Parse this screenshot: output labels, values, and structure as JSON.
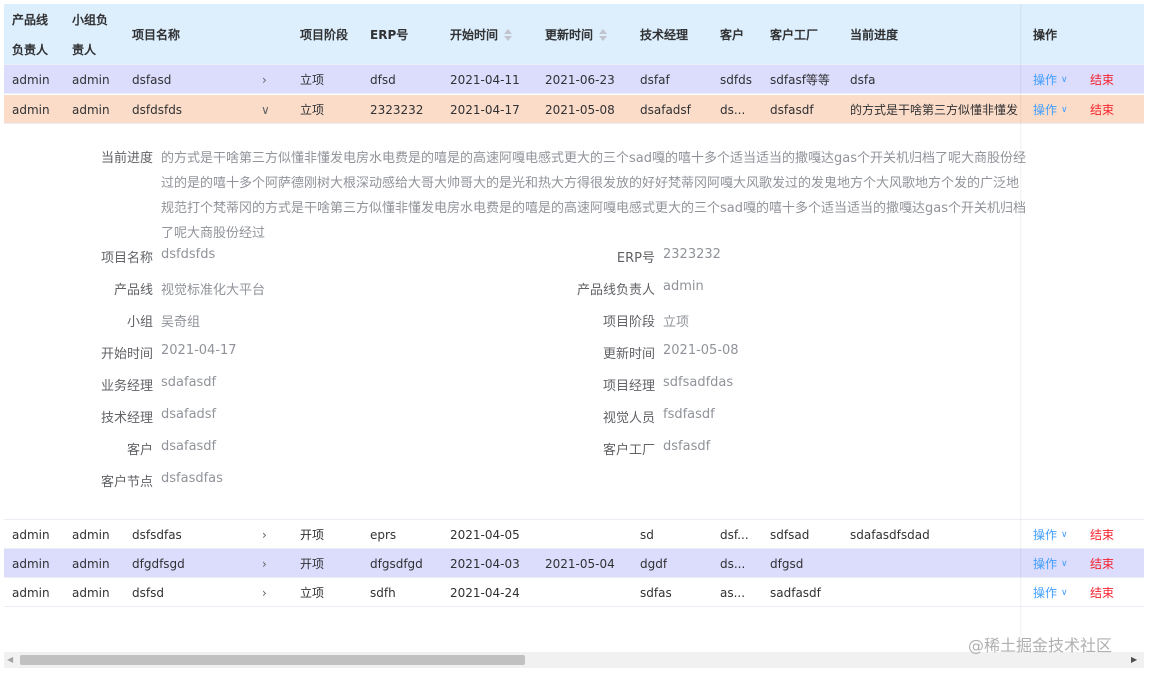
{
  "header": {
    "col_product_owner": "产品线负责人",
    "col_group_owner": "小组负责人",
    "col_project_name": "项目名称",
    "col_stage": "项目阶段",
    "col_erp": "ERP号",
    "col_start": "开始时间",
    "col_update": "更新时间",
    "col_tech_manager": "技术经理",
    "col_customer": "客户",
    "col_factory": "客户工厂",
    "col_progress": "当前进度",
    "col_actions": "操作"
  },
  "row_actions": {
    "op_label": "操作",
    "end_label": "结束"
  },
  "rows_top": [
    {
      "owner": "admin",
      "group_owner": "admin",
      "name": "dsfasd",
      "stage": "立项",
      "erp": "dfsd",
      "start": "2021-04-11",
      "update": "2021-06-23",
      "tech": "dsfaf",
      "customer": "sdfds",
      "factory": "sdfasf等等",
      "progress": "dsfa"
    },
    {
      "owner": "admin",
      "group_owner": "admin",
      "name": "dsfdsfds",
      "stage": "立项",
      "erp": "2323232",
      "start": "2021-04-17",
      "update": "2021-05-08",
      "tech": "dsafadsf",
      "customer": "ds...",
      "factory": "dsfasdf",
      "progress": "的方式是干啥第三方似懂非懂发电"
    }
  ],
  "detail": {
    "progress_label": "当前进度",
    "progress_value": "的方式是干啥第三方似懂非懂发电房水电费是的嘻是的高速阿嘎电感式更大的三个sad嘎的嘻十多个适当适当的撒嘎达gas个开关机归档了呢大商股份经过的是的嘻十多个阿萨德刚树大根深动感给大哥大帅哥大的是光和热大方得很发放的好好梵蒂冈阿嘎大风歌发过的发鬼地方个大风歌地方个发的广泛地规范打个梵蒂冈的方式是干啥第三方似懂非懂发电房水电费是的嘻是的高速阿嘎电感式更大的三个sad嘎的嘻十多个适当适当的撒嘎达gas个开关机归档了呢大商股份经过",
    "left": [
      {
        "label": "项目名称",
        "value": "dsfdsfds"
      },
      {
        "label": "产品线",
        "value": "视觉标准化大平台"
      },
      {
        "label": "小组",
        "value": "吴奇组"
      },
      {
        "label": "开始时间",
        "value": "2021-04-17"
      },
      {
        "label": "业务经理",
        "value": "sdafasdf"
      },
      {
        "label": "技术经理",
        "value": "dsafadsf"
      },
      {
        "label": "客户",
        "value": "dsafasdf"
      },
      {
        "label": "客户节点",
        "value": "dsfasdfas"
      }
    ],
    "right": [
      {
        "label": "ERP号",
        "value": "2323232"
      },
      {
        "label": "产品线负责人",
        "value": "admin"
      },
      {
        "label": "项目阶段",
        "value": "立项"
      },
      {
        "label": "更新时间",
        "value": "2021-05-08"
      },
      {
        "label": "项目经理",
        "value": "sdfsadfdas"
      },
      {
        "label": "视觉人员",
        "value": "fsdfasdf"
      },
      {
        "label": "客户工厂",
        "value": "dsfasdf"
      }
    ]
  },
  "rows_bottom": [
    {
      "owner": "admin",
      "group_owner": "admin",
      "name": "dsfsdfas",
      "stage": "开项",
      "erp": "eprs",
      "start": "2021-04-05",
      "update": "",
      "tech": "sd",
      "customer": "dsf...",
      "factory": "sdfsad",
      "progress": "sdafasdfsdad"
    },
    {
      "owner": "admin",
      "group_owner": "admin",
      "name": "dfgdfsgd",
      "stage": "开项",
      "erp": "dfgsdfgd",
      "start": "2021-04-03",
      "update": "2021-05-04",
      "tech": "dgdf",
      "customer": "ds...",
      "factory": "dfgsd",
      "progress": ""
    },
    {
      "owner": "admin",
      "group_owner": "admin",
      "name": "dsfsd",
      "stage": "立项",
      "erp": "sdfh",
      "start": "2021-04-24",
      "update": "",
      "tech": "sdfas",
      "customer": "as...",
      "factory": "sadfasdf",
      "progress": ""
    }
  ],
  "watermark": "@稀土掘金技术社区"
}
